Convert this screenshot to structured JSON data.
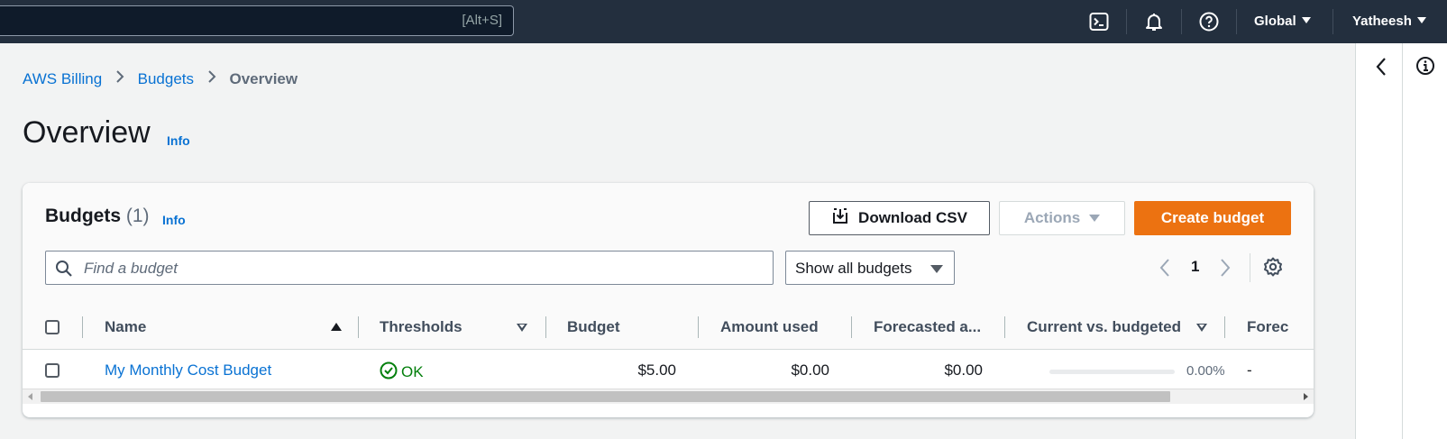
{
  "topbar": {
    "search_shortcut": "[Alt+S]",
    "region_label": "Global",
    "user_label": "Yatheesh"
  },
  "breadcrumb": {
    "items": [
      "AWS Billing",
      "Budgets"
    ],
    "current": "Overview"
  },
  "page": {
    "title": "Overview",
    "info_label": "Info"
  },
  "budgets_panel": {
    "title": "Budgets",
    "count": "(1)",
    "info_label": "Info",
    "download_label": "Download CSV",
    "actions_label": "Actions",
    "create_label": "Create budget",
    "search_placeholder": "Find a budget",
    "filter_selected": "Show all budgets",
    "page_number": "1"
  },
  "table": {
    "columns": [
      "Name",
      "Thresholds",
      "Budget",
      "Amount used",
      "Forecasted a...",
      "Current vs. budgeted",
      "Forec"
    ],
    "rows": [
      {
        "name": "My Monthly Cost Budget",
        "thresholds": "OK",
        "budget": "$5.00",
        "amount_used": "$0.00",
        "forecasted": "$0.00",
        "current_vs_budgeted_pct": "0.00%",
        "current_vs_budgeted_fraction": 0,
        "forecast_vs": "-"
      }
    ]
  },
  "colors": {
    "topbar_bg": "#232f3e",
    "link": "#0972d3",
    "primary_button": "#ec7211",
    "success": "#037f0c"
  },
  "icons": [
    "cloudshell-icon",
    "bell-icon",
    "help-icon",
    "chevron-left-icon",
    "info-circle-icon",
    "download-icon",
    "search-icon",
    "settings-gear-icon",
    "check-circle-icon"
  ]
}
